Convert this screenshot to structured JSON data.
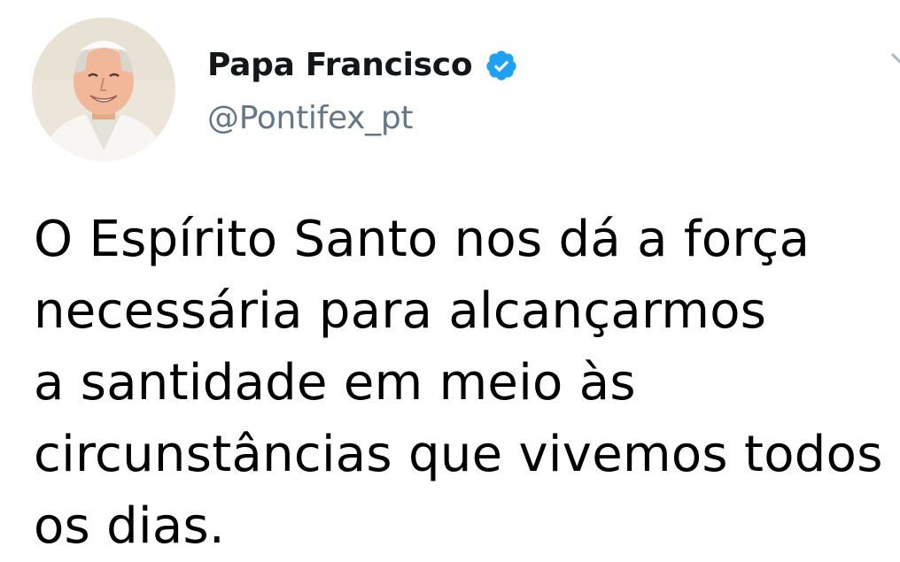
{
  "tweet": {
    "author": {
      "display_name": "Papa Francisco",
      "handle": "@Pontifex_pt",
      "verified": true,
      "avatar_icon": "pope-portrait-avatar"
    },
    "text_lines": [
      "O Espírito Santo nos dá a força",
      "necessária para alcançarmos",
      "a santidade em meio às",
      "circunstâncias que vivemos todos",
      "os dias."
    ]
  },
  "colors": {
    "verified_badge": "#1da1f2",
    "handle": "#657786",
    "text": "#000000"
  }
}
